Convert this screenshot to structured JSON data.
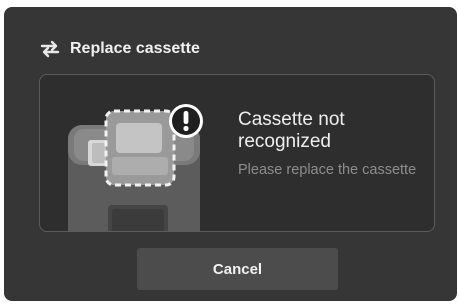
{
  "dialog": {
    "title": "Replace cassette",
    "title_icon": "swap-arrows-icon",
    "warning_icon": "exclamation-icon",
    "message_title": "Cassette not recognized",
    "message_subtitle": "Please replace the cassette",
    "cancel_label": "Cancel"
  },
  "colors": {
    "dialog_bg": "#363636",
    "panel_bg": "#2e2e2e",
    "panel_border": "#5b5b5b",
    "button_bg": "#4c4c4c",
    "subtitle_text": "#8d8d8d"
  }
}
